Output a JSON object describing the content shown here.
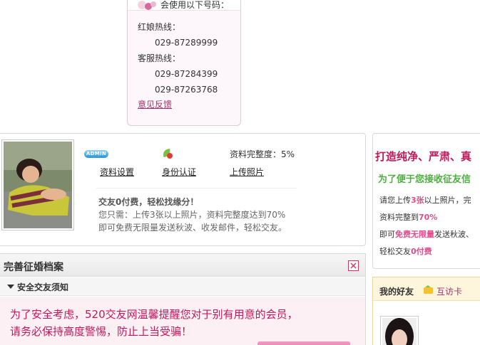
{
  "contact": {
    "header": "会使用以下号码：",
    "matchmaker_label": "红娘热线：",
    "matchmaker_number": "029-87289999",
    "service_label": "客服热线：",
    "service_numbers": [
      "029-87284399",
      "029-87263768"
    ],
    "feedback_link": "意见反馈"
  },
  "profile": {
    "badge": "ADMIN",
    "completeness_label": "资料完整度：",
    "completeness_value": "5%",
    "completeness_fraction": 0.05,
    "links": [
      "资料设置",
      "身份认证",
      "上传照片"
    ],
    "free_title": "交友0付费，轻松找缘分！",
    "free_desc": [
      "您只需：上传3张以上照片，资料完整度达到70%",
      "即可免费无限量发送秋波、收发邮件，轻松交友。"
    ]
  },
  "file_panel": {
    "title": "完善征婚档案",
    "section": "安全交友须知",
    "warning": [
      "为了安全考虑，520交友网温馨提醒您对于别有用意的会员，",
      "请务必保持高度警惕，防止上当受骗！"
    ]
  },
  "right_promo": {
    "title": "打造纯净、严肃、真",
    "subtitle": "为了便于您接收征友信",
    "lines": [
      [
        "请您上传",
        "3张",
        "以上照片，完"
      ],
      [
        "资料完整到",
        "70%",
        ""
      ],
      [
        "即可",
        "免费无限量",
        "发送秋波、"
      ],
      [
        "轻松交友",
        "0付费",
        ""
      ]
    ]
  },
  "friends": {
    "title": "我的好友",
    "link": "互访卡"
  },
  "colors": {
    "accent_pink": "#c2185b",
    "accent_green": "#4caf3f",
    "link": "#a0336d"
  }
}
